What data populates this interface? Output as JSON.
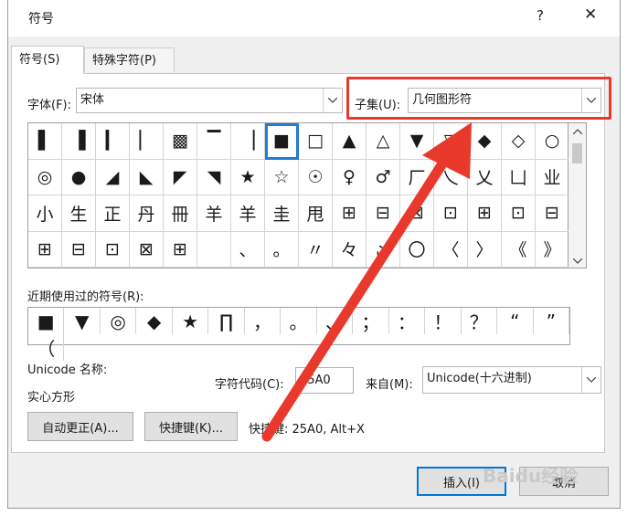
{
  "window": {
    "title": "符号",
    "help": "?",
    "close": "✕"
  },
  "tabs": [
    {
      "label": "符号(S)"
    },
    {
      "label": "特殊字符(P)"
    }
  ],
  "font": {
    "label": "字体(F):",
    "value": "宋体"
  },
  "subset": {
    "label": "子集(U):",
    "value": "几何图形符"
  },
  "symbol_grid": {
    "rows": [
      [
        "▌",
        "▐",
        "▎",
        "▏",
        "▩",
        "▔",
        "▕",
        "■",
        "□",
        "▲",
        "△",
        "▼",
        "▽",
        "◆",
        "◇",
        "○"
      ],
      [
        "◎",
        "●",
        "◢",
        "◣",
        "◤",
        "◥",
        "★",
        "☆",
        "☉",
        "♀",
        "♂",
        "厂",
        "乀",
        "乂",
        "凵",
        "业"
      ],
      [
        "小",
        "生",
        "正",
        "丹",
        "冊",
        "羊",
        "羊",
        "圭",
        "甩",
        "⊞",
        "⊟",
        "⊠",
        "⊡",
        "⊞",
        "⊡",
        "⊟"
      ],
      [
        "⊞",
        "⊟",
        "⊡",
        "⊠",
        "⊞",
        "",
        "、",
        "。",
        "〃",
        "々",
        "〆",
        "〇",
        "〈",
        "〉",
        "《",
        "》"
      ]
    ],
    "selected": "■"
  },
  "recent": {
    "label": "近期使用过的符号(R):",
    "symbols": [
      "■",
      "▼",
      "◎",
      "◆",
      "★",
      "∏",
      "，",
      "。",
      "、",
      "；",
      "：",
      "！",
      "？",
      "“",
      "”",
      "（"
    ]
  },
  "unicode": {
    "name_label": "Unicode 名称:",
    "name_value": "实心方形"
  },
  "charcode": {
    "label": "字符代码(C):",
    "value": "25A0"
  },
  "from": {
    "label": "来自(M):",
    "value": "Unicode(十六进制)"
  },
  "buttons": {
    "autocorrect": "自动更正(A)...",
    "shortcut": "快捷键(K)...",
    "insert": "插入(I)",
    "cancel": "取消"
  },
  "shortcut_text": "快捷键: 25A0, Alt+X",
  "watermark": "Baidu经验",
  "colors": {
    "highlight": "#e8392c",
    "selection": "#1f7bd6"
  }
}
